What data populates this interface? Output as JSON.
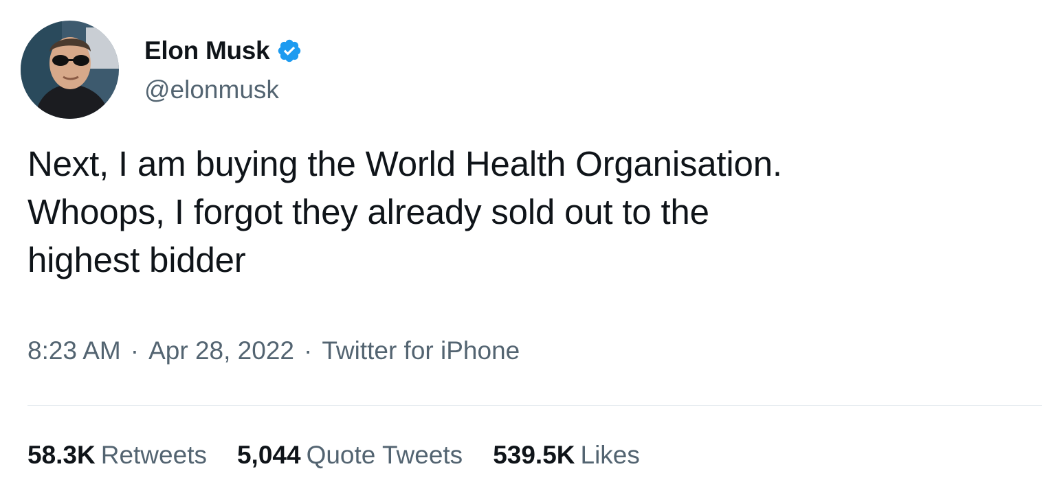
{
  "author": {
    "display_name": "Elon Musk",
    "handle": "@elonmusk",
    "verified_icon": "verified-badge-icon",
    "verified_color": "#1d9bf0"
  },
  "tweet": {
    "text": "Next, I am buying the World Health Organisation.\nWhoops, I forgot they already sold out to the\nhighest bidder",
    "time": "8:23 AM",
    "separator": "·",
    "date": "Apr 28, 2022",
    "source": "Twitter for iPhone"
  },
  "stats": [
    {
      "count": "58.3K",
      "label": "Retweets"
    },
    {
      "count": "5,044",
      "label": "Quote Tweets"
    },
    {
      "count": "539.5K",
      "label": "Likes"
    }
  ],
  "colors": {
    "text_primary": "#0f1419",
    "text_secondary": "#536471",
    "divider": "#e6ecf0"
  }
}
